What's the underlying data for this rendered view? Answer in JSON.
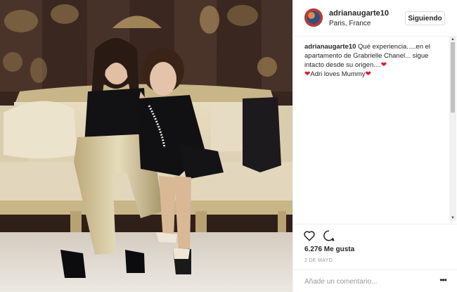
{
  "post": {
    "username": "adrianaugarte10",
    "location": "Paris, France",
    "follow_label": "Siguiendo",
    "caption_user": "adrianaugarte10",
    "caption_text": " Qué experiencia.....en el apartamento de Grabrielle Chanel... sigue intacto desde su origen....",
    "caption_line2": "Adri loves Mummy",
    "likes": "6.276 Me gusta",
    "date": "2 DE MAYO",
    "comment_placeholder": "Añade un comentario...",
    "more": "•••"
  },
  "icons": {
    "like": "heart-outline-icon",
    "comment": "speech-bubble-icon",
    "heart_emoji": "red-heart-emoji-icon",
    "more": "ellipsis-icon"
  },
  "colors": {
    "heart": "#e0192d",
    "text": "#262626",
    "muted": "#999999",
    "border": "#efefef"
  }
}
